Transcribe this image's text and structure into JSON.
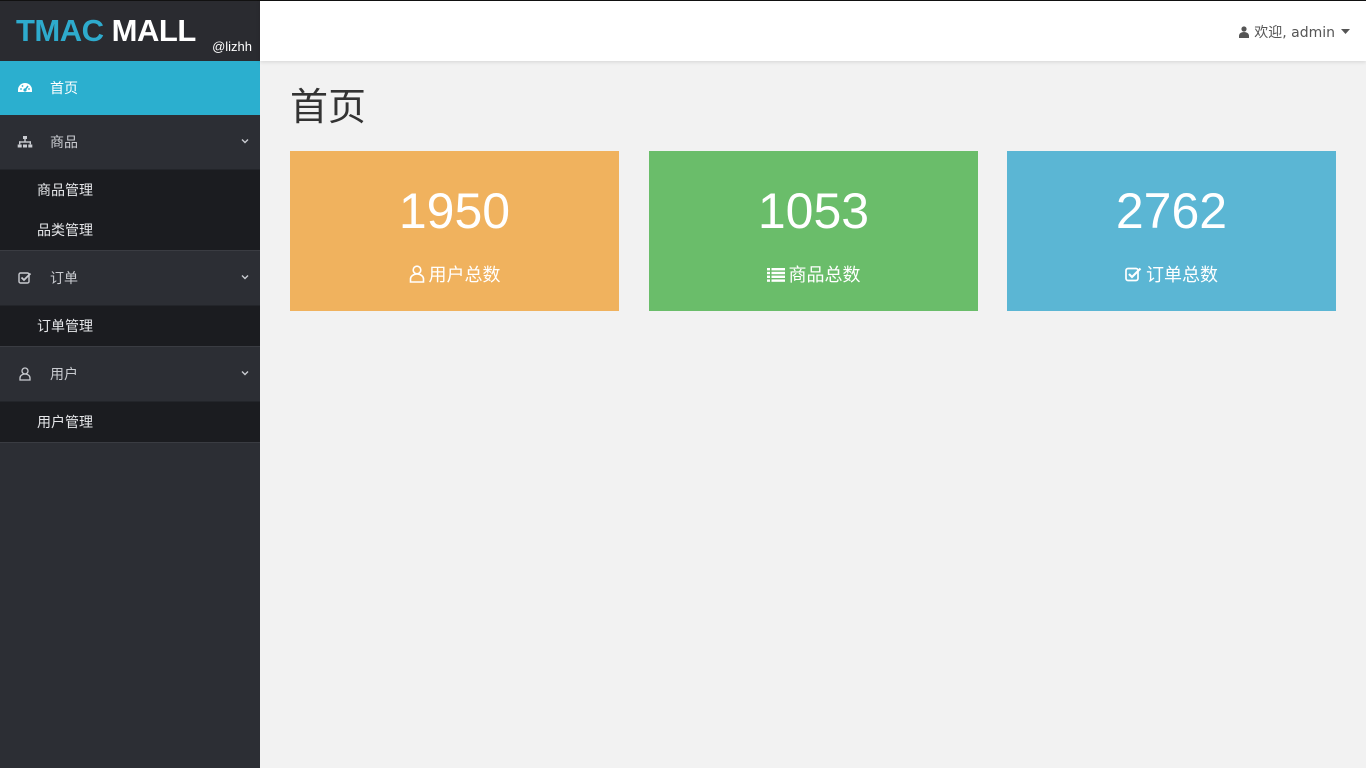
{
  "brand": {
    "part1": "TMAC",
    "part2": "MALL",
    "sub": "@lizhh"
  },
  "sidebar": {
    "home": {
      "label": "首页",
      "icon": "dashboard-icon"
    },
    "groups": [
      {
        "label": "商品",
        "icon": "sitemap-icon",
        "items": [
          "商品管理",
          "品类管理"
        ]
      },
      {
        "label": "订单",
        "icon": "check-square-icon",
        "items": [
          "订单管理"
        ]
      },
      {
        "label": "用户",
        "icon": "user-icon",
        "items": [
          "用户管理"
        ]
      }
    ]
  },
  "header": {
    "welcome": "欢迎, admin"
  },
  "main": {
    "title": "首页",
    "cards": [
      {
        "value": "1950",
        "label": "用户总数",
        "icon": "user-icon",
        "color": "#f0b25e"
      },
      {
        "value": "1053",
        "label": "商品总数",
        "icon": "list-icon",
        "color": "#6abd6a"
      },
      {
        "value": "2762",
        "label": "订单总数",
        "icon": "check-square-icon",
        "color": "#5bb6d4"
      }
    ]
  },
  "colors": {
    "accent": "#2bafcf",
    "sidebar_bg": "#2c2e34",
    "submenu_bg": "#1b1c20"
  }
}
